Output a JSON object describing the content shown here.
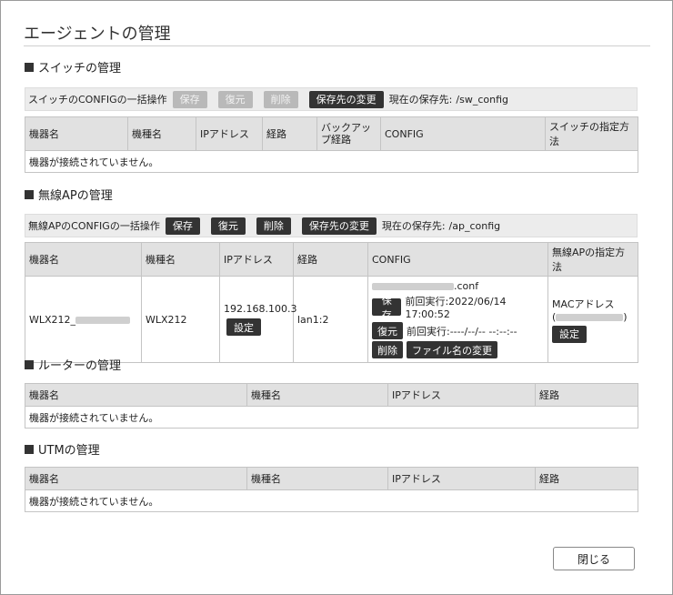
{
  "dialog": {
    "title": "エージェントの管理",
    "close_label": "閉じる"
  },
  "switch": {
    "heading": "スイッチの管理",
    "bulk_label": "スイッチのCONFIGの一括操作",
    "buttons": {
      "save": "保存",
      "restore": "復元",
      "delete": "削除",
      "change_dest": "保存先の変更"
    },
    "current_dest_label": "現在の保存先:",
    "current_dest": "/sw_config",
    "columns": [
      "機器名",
      "機種名",
      "IPアドレス",
      "経路",
      "バックアップ経路",
      "CONFIG",
      "スイッチの指定方法"
    ],
    "empty_message": "機器が接続されていません。"
  },
  "ap": {
    "heading": "無線APの管理",
    "bulk_label": "無線APのCONFIGの一括操作",
    "buttons": {
      "save": "保存",
      "restore": "復元",
      "delete": "削除",
      "change_dest": "保存先の変更"
    },
    "current_dest_label": "現在の保存先:",
    "current_dest": "/ap_config",
    "columns": [
      "機器名",
      "機種名",
      "IPアドレス",
      "経路",
      "CONFIG",
      "無線APの指定方法"
    ],
    "rows": [
      {
        "device_name": "WLX212_",
        "model": "WLX212",
        "ip": "192.168.100.3",
        "ip_setting_button": "設定",
        "route": "lan1:2",
        "config_file_suffix": ".conf",
        "save_button": "保存",
        "save_last_run": "前回実行:2022/06/14 17:00:52",
        "restore_button": "復元",
        "restore_last_run": "前回実行:----/--/-- --:--:--",
        "delete_button": "削除",
        "rename_button": "ファイル名の変更",
        "spec_method": "MACアドレス",
        "spec_paren_open": "(",
        "spec_paren_close": ")",
        "spec_setting_button": "設定"
      }
    ]
  },
  "router": {
    "heading": "ルーターの管理",
    "columns": [
      "機器名",
      "機種名",
      "IPアドレス",
      "経路"
    ],
    "empty_message": "機器が接続されていません。"
  },
  "utm": {
    "heading": "UTMの管理",
    "columns": [
      "機器名",
      "機種名",
      "IPアドレス",
      "経路"
    ],
    "empty_message": "機器が接続されていません。"
  }
}
